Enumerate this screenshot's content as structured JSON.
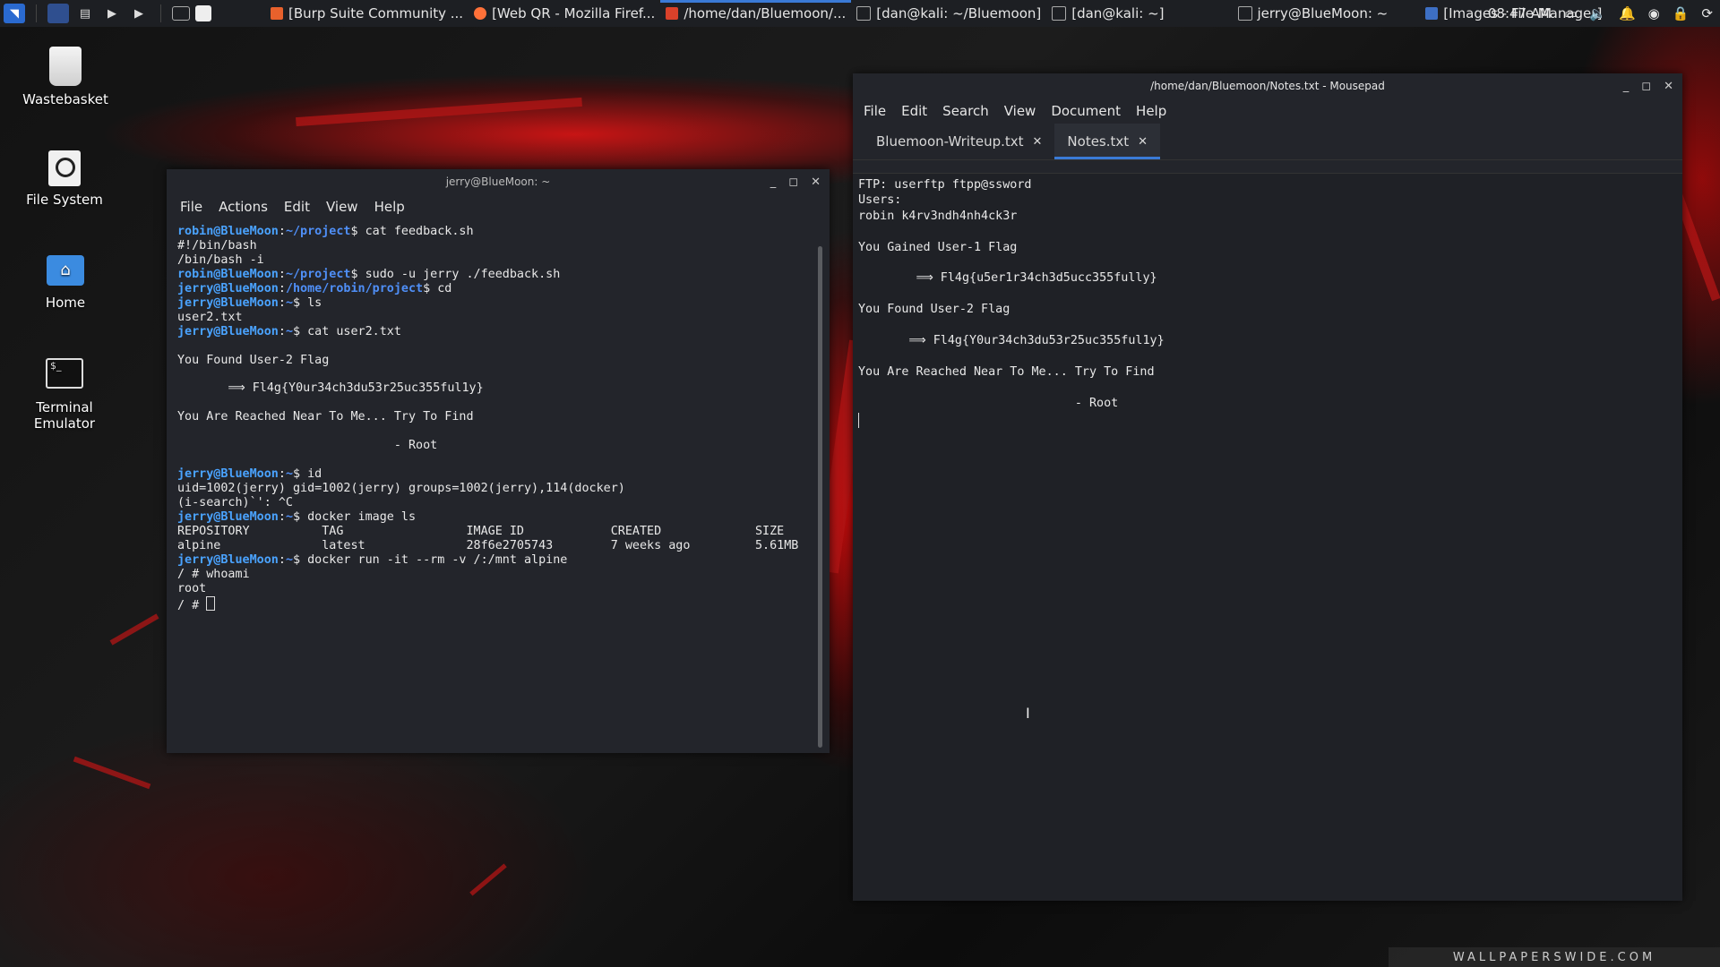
{
  "panel": {
    "tasks": [
      {
        "label": "[Burp Suite Community ...",
        "icon": "burp-icon",
        "color": "#e8612c"
      },
      {
        "label": "[Web QR - Mozilla Firef...",
        "icon": "firefox-icon",
        "color": "#ff7139"
      },
      {
        "label": "/home/dan/Bluemoon/...",
        "icon": "mousepad-icon",
        "color": "#d9412a"
      },
      {
        "label": "[dan@kali: ~/Bluemoon]",
        "icon": "terminal-icon",
        "color": "#444"
      },
      {
        "label": "[dan@kali: ~]",
        "icon": "terminal-icon",
        "color": "#444"
      },
      {
        "label": "jerry@BlueMoon: ~",
        "icon": "terminal-icon",
        "color": "#444"
      },
      {
        "label": "[Images - File Manager]",
        "icon": "folder-icon",
        "color": "#3d6fc4"
      }
    ],
    "clock": "08:47 AM"
  },
  "desktop": {
    "icons": [
      {
        "label": "Wastebasket",
        "icon": "trash-icon"
      },
      {
        "label": "File System",
        "icon": "drive-icon"
      },
      {
        "label": "Home",
        "icon": "home-folder-icon"
      },
      {
        "label": "Terminal Emulator",
        "icon": "terminal-icon"
      }
    ]
  },
  "terminal": {
    "title": "jerry@BlueMoon: ~",
    "menu": [
      "File",
      "Actions",
      "Edit",
      "View",
      "Help"
    ]
  },
  "mousepad": {
    "title": "/home/dan/Bluemoon/Notes.txt - Mousepad",
    "menu": [
      "File",
      "Edit",
      "Search",
      "View",
      "Document",
      "Help"
    ],
    "tabs": [
      "Bluemoon-Writeup.txt",
      "Notes.txt"
    ],
    "content": "FTP: userftp ftpp@ssword\nUsers:\nrobin k4rv3ndh4nh4ck3r\n\nYou Gained User-1 Flag\n\n        ⟹ Fl4g{u5er1r34ch3d5ucc355fully}\n\nYou Found User-2 Flag\n\n       ⟹ Fl4g{Y0ur34ch3du53r25uc355ful1y}\n\nYou Are Reached Near To Me... Try To Find\n\n                              - Root"
  },
  "watermark": "WALLPAPERSWIDE.COM"
}
